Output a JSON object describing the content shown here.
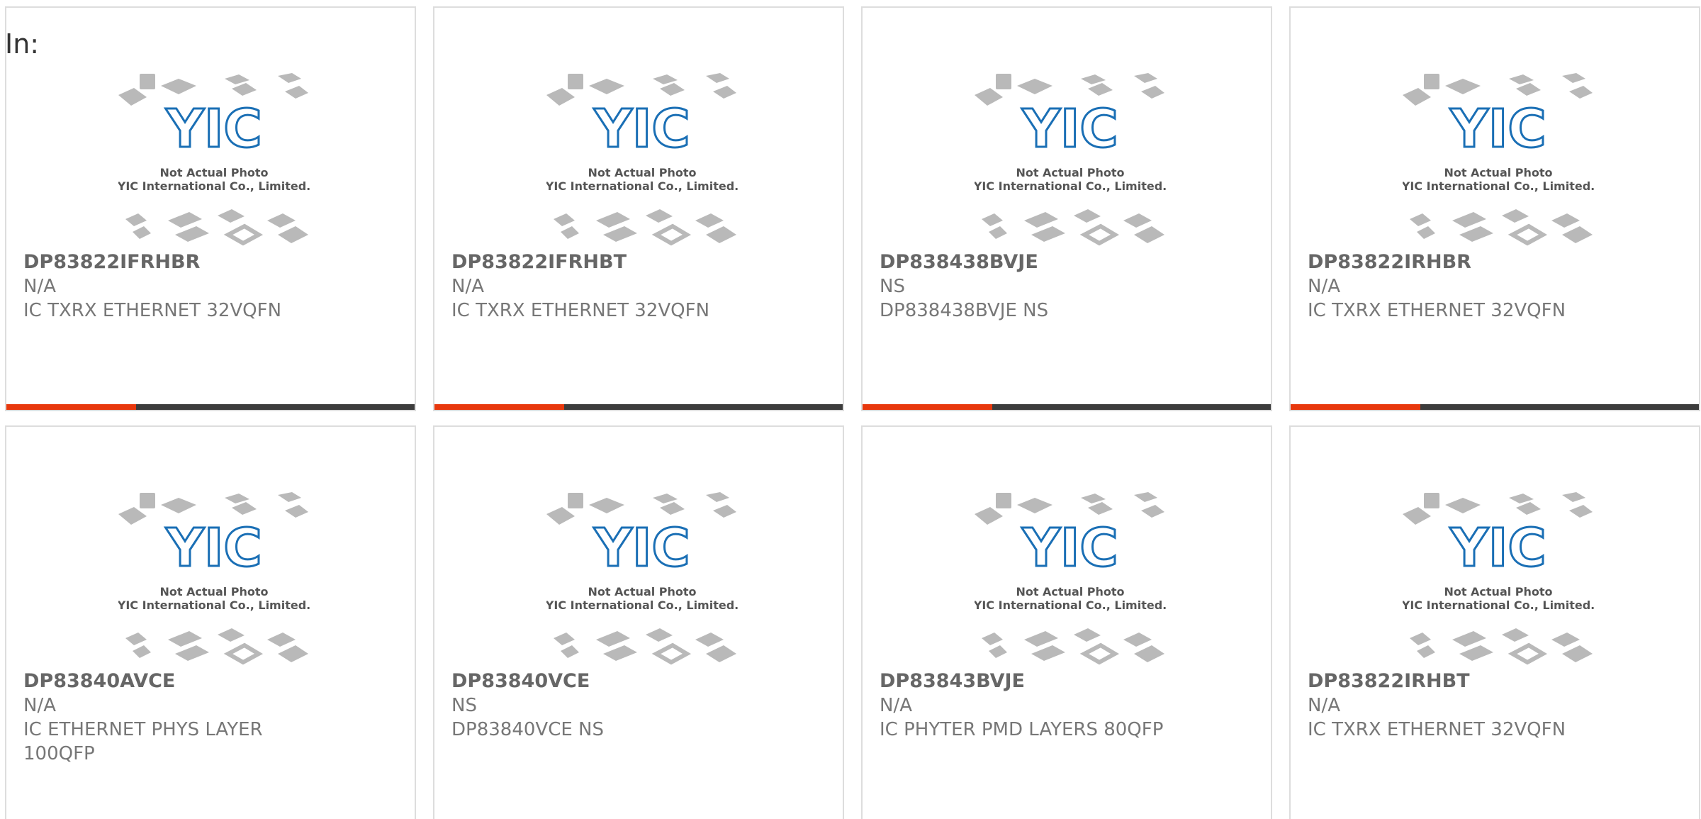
{
  "header": {
    "label": "In:"
  },
  "photo": {
    "caption_line1": "Not Actual Photo",
    "caption_line2": "YIC International Co., Limited.",
    "logo_text": "YIC",
    "logo_color": "#1a6fb5"
  },
  "accent_color": "#e8380d",
  "bar_color": "#3c3c3c",
  "products": [
    {
      "part": "DP83822IFRHBR",
      "mfr": "N/A",
      "desc": "IC TXRX ETHERNET 32VQFN"
    },
    {
      "part": "DP83822IFRHBT",
      "mfr": "N/A",
      "desc": "IC TXRX ETHERNET 32VQFN"
    },
    {
      "part": "DP838438BVJE",
      "mfr": "NS",
      "desc": "DP838438BVJE NS"
    },
    {
      "part": "DP83822IRHBR",
      "mfr": "N/A",
      "desc": "IC TXRX ETHERNET 32VQFN"
    },
    {
      "part": "DP83840AVCE",
      "mfr": "N/A",
      "desc": "IC ETHERNET PHYS LAYER 100QFP"
    },
    {
      "part": "DP83840VCE",
      "mfr": "NS",
      "desc": "DP83840VCE NS"
    },
    {
      "part": "DP83843BVJE",
      "mfr": "N/A",
      "desc": "IC PHYTER PMD LAYERS 80QFP"
    },
    {
      "part": "DP83822IRHBT",
      "mfr": "N/A",
      "desc": "IC TXRX ETHERNET 32VQFN"
    }
  ]
}
